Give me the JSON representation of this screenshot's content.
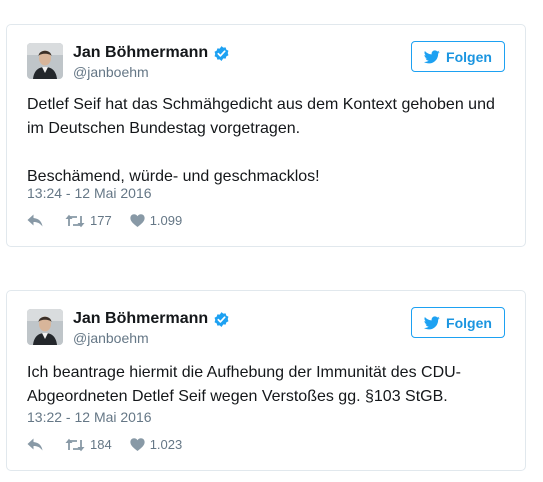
{
  "tweets": [
    {
      "display_name": "Jan Böhmermann",
      "handle": "@janboehm",
      "follow_label": "Folgen",
      "text": "Detlef Seif hat das Schmähgedicht aus dem Kontext gehoben und im Deutschen Bundestag vorgetragen.\n\nBeschämend, würde- und geschmacklos!",
      "timestamp": "13:24 - 12 Mai 2016",
      "retweets": "177",
      "likes": "1.099"
    },
    {
      "display_name": "Jan Böhmermann",
      "handle": "@janboehm",
      "follow_label": "Folgen",
      "text": "Ich beantrage hiermit die Aufhebung der Immunität des CDU-Abgeordneten Detlef Seif wegen Verstoßes gg. §103 StGB.",
      "timestamp": "13:22 - 12 Mai 2016",
      "retweets": "184",
      "likes": "1.023"
    }
  ],
  "colors": {
    "accent": "#1da1f2",
    "text": "#14171a",
    "muted": "#657786",
    "border": "#e1e8ed"
  },
  "icons": {
    "verified": "verified-badge-icon",
    "follow": "twitter-bird-icon",
    "reply": "reply-icon",
    "retweet": "retweet-icon",
    "like": "heart-icon"
  }
}
